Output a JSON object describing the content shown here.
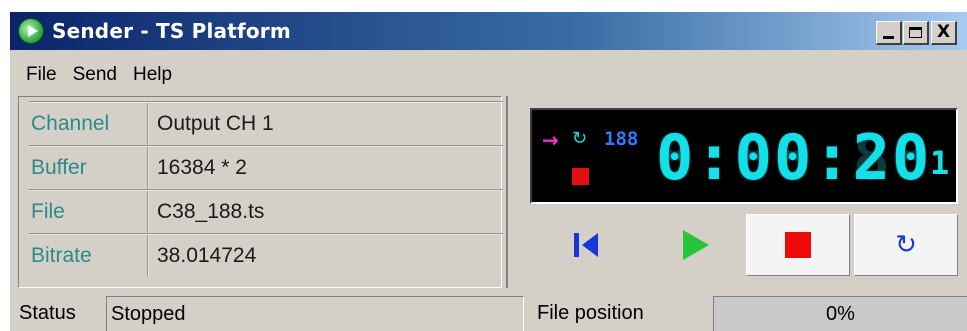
{
  "window": {
    "title": "Sender - TS Platform",
    "controls": {
      "minimize": "_",
      "maximize": "□",
      "close": "X"
    }
  },
  "menu": [
    "File",
    "Send",
    "Help"
  ],
  "info": {
    "rows": [
      {
        "label": "Channel",
        "value": "Output CH 1"
      },
      {
        "label": "Buffer",
        "value": "16384 * 2"
      },
      {
        "label": "File",
        "value": "C38_188.ts"
      },
      {
        "label": "Bitrate",
        "value": "38.014724"
      }
    ]
  },
  "display": {
    "send_indicator": "→",
    "loop_indicator": "↻",
    "packet_size": "188",
    "time": "0:00:20",
    "ghost_time": "8:88:88",
    "extra_digit": "1",
    "colors": {
      "time": "#14e0ea",
      "arrow": "#ff2bd6",
      "packet": "#2a7bff",
      "stop": "#e01010"
    }
  },
  "controls": {
    "first_icon": "skip-to-start-icon",
    "play_icon": "play-icon",
    "stop_icon": "stop-icon",
    "loop_icon": "loop-icon",
    "loop_glyph": "↻"
  },
  "status": {
    "label": "Status",
    "value": "Stopped",
    "position_label": "File position",
    "position_value": "0%",
    "position_fraction": 0
  }
}
